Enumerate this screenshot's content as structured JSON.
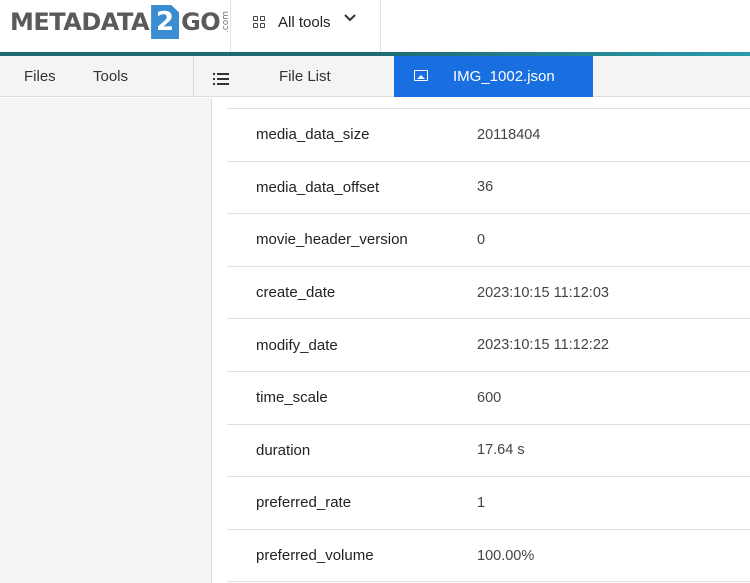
{
  "brand": {
    "logo_left": "METADATA",
    "logo_num": "2",
    "logo_right": "GO",
    "logo_suffix": ".com"
  },
  "header": {
    "all_tools_label": "All tools"
  },
  "nav": {
    "files_label": "Files",
    "tools_label": "Tools",
    "file_list_label": "File List",
    "active_tab_label": "IMG_1002.json"
  },
  "metadata_rows": [
    {
      "key": "media_data_size",
      "value": "20118404"
    },
    {
      "key": "media_data_offset",
      "value": "36"
    },
    {
      "key": "movie_header_version",
      "value": "0"
    },
    {
      "key": "create_date",
      "value": "2023:10:15 11:12:03"
    },
    {
      "key": "modify_date",
      "value": "2023:10:15 11:12:22"
    },
    {
      "key": "time_scale",
      "value": "600"
    },
    {
      "key": "duration",
      "value": "17.64 s"
    },
    {
      "key": "preferred_rate",
      "value": "1"
    },
    {
      "key": "preferred_volume",
      "value": "100.00%"
    }
  ],
  "colors": {
    "accent_blue": "#1a6fe0",
    "teal_bar": "#1e6a73",
    "logo_blue": "#3a8dd0"
  }
}
